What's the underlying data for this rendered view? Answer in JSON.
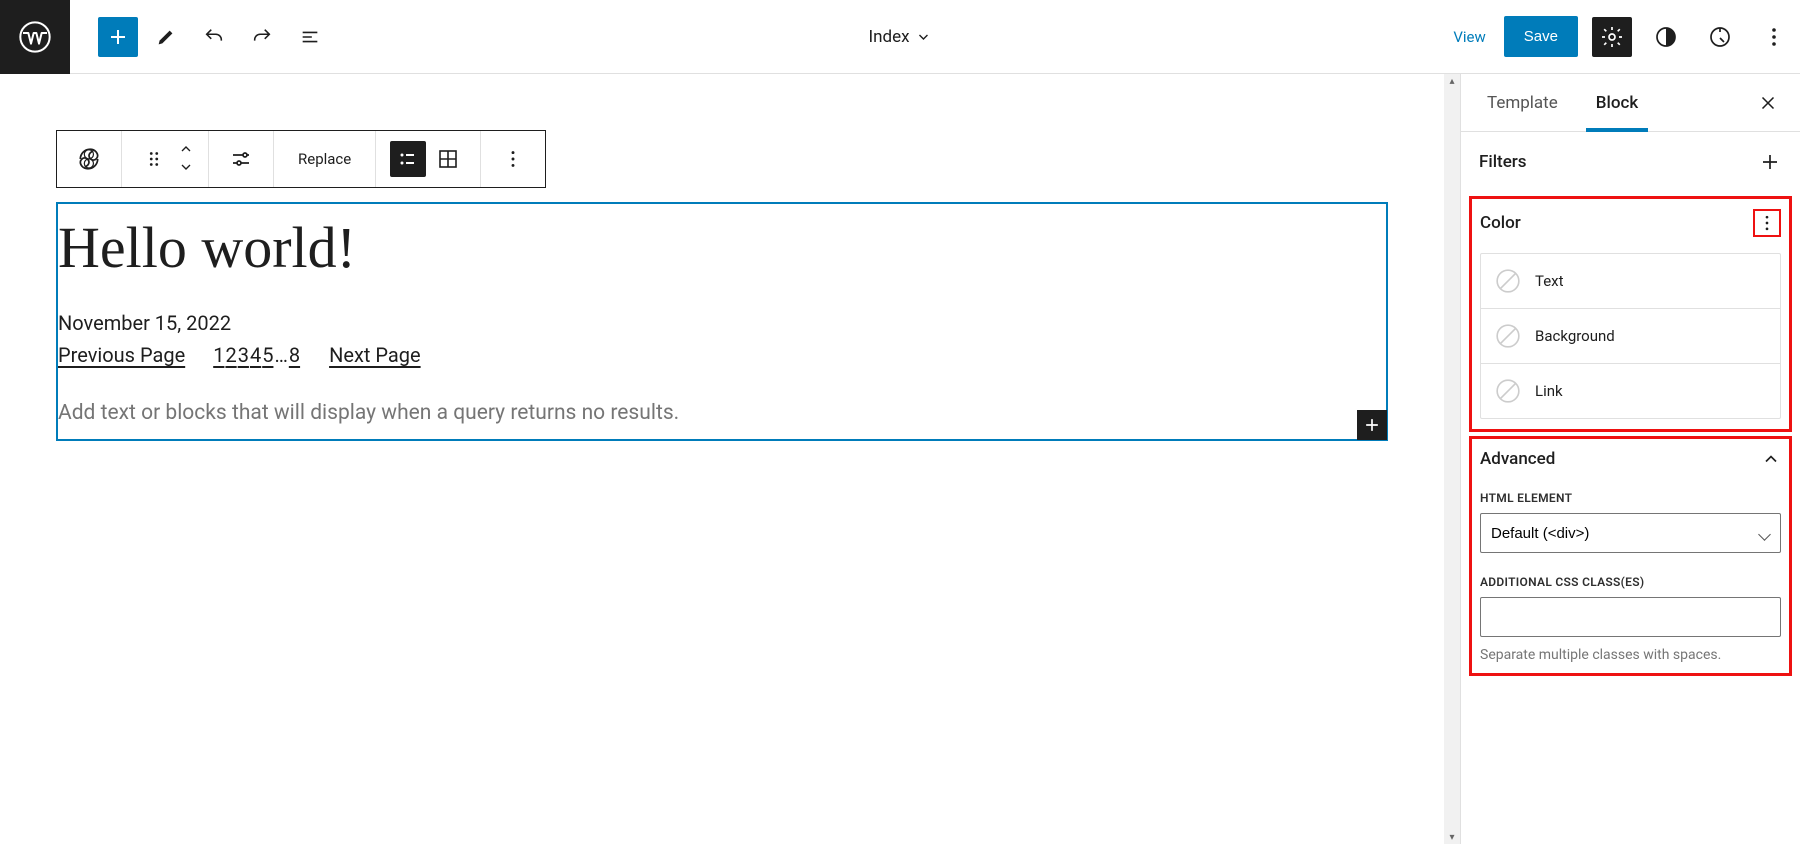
{
  "header": {
    "document_title": "Index",
    "view_label": "View",
    "save_label": "Save"
  },
  "block_toolbar": {
    "replace_label": "Replace"
  },
  "canvas": {
    "post_title": "Hello world!",
    "post_date": "November 15, 2022",
    "prev_page": "Previous Page",
    "next_page": "Next Page",
    "pages": [
      "1",
      "2",
      "3",
      "4",
      "5",
      "…",
      "8"
    ],
    "no_results_placeholder": "Add text or blocks that will display when a query returns no results."
  },
  "sidebar": {
    "tabs": {
      "template": "Template",
      "block": "Block"
    },
    "filters_title": "Filters",
    "color": {
      "title": "Color",
      "text": "Text",
      "background": "Background",
      "link": "Link"
    },
    "advanced": {
      "title": "Advanced",
      "html_element_label": "HTML ELEMENT",
      "html_element_value": "Default (<div>)",
      "css_label": "ADDITIONAL CSS CLASS(ES)",
      "css_help": "Separate multiple classes with spaces."
    }
  }
}
